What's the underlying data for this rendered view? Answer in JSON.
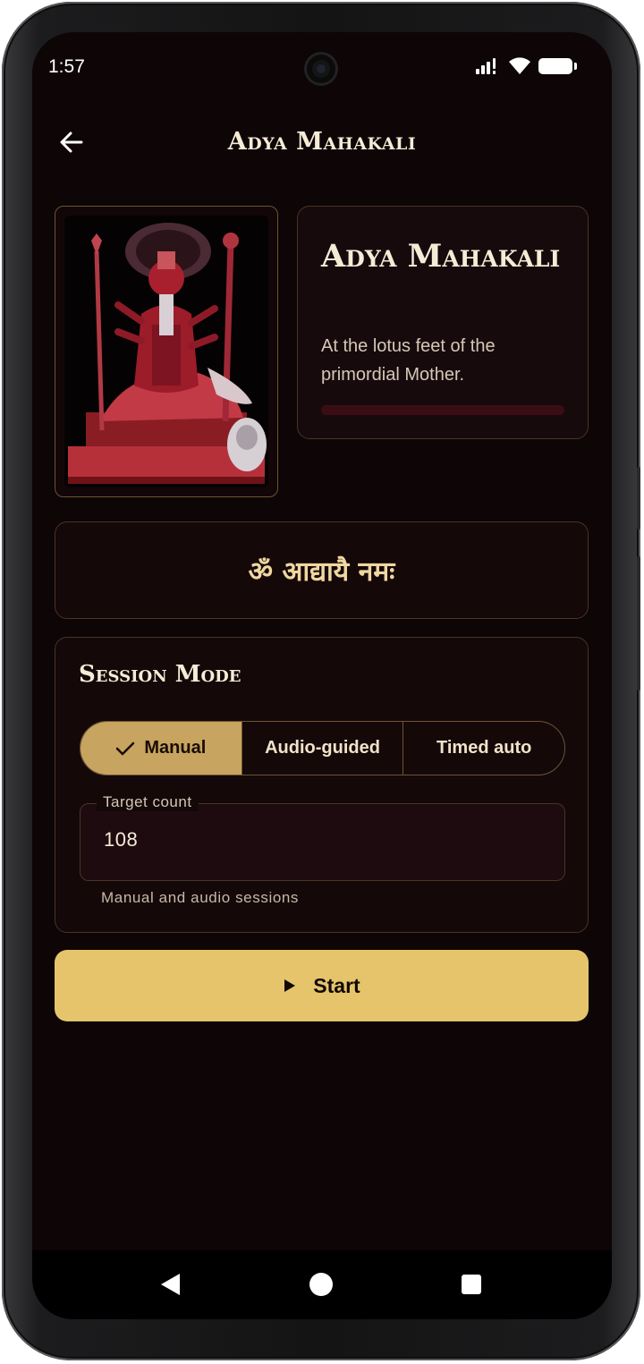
{
  "status_bar": {
    "time": "1:57"
  },
  "app_bar": {
    "title": "Adya Mahakali"
  },
  "deity": {
    "name": "Adya Mahakali",
    "subtitle": "At the lotus feet of the primordial Mother.",
    "progress": 0
  },
  "mantra": "ॐ आद्यायै नमः",
  "session": {
    "title": "Session Mode",
    "modes": [
      {
        "label": "Manual",
        "selected": true
      },
      {
        "label": "Audio-guided",
        "selected": false
      },
      {
        "label": "Timed auto",
        "selected": false
      }
    ],
    "target_count_label": "Target count",
    "target_count_value": "108",
    "helper_text": "Manual and audio sessions"
  },
  "start_button": {
    "label": "Start"
  },
  "icons": {
    "back": "arrow-left-icon",
    "check": "check-icon",
    "play": "play-icon",
    "nav_back": "triangle-back-icon",
    "nav_home": "circle-home-icon",
    "nav_recents": "square-recents-icon"
  },
  "colors": {
    "background": "#0d0506",
    "accent_gold": "#e5c46c",
    "selected_segment": "#c7a45f",
    "progress_track": "#3a0d14",
    "text_primary": "#f6ecd6"
  }
}
